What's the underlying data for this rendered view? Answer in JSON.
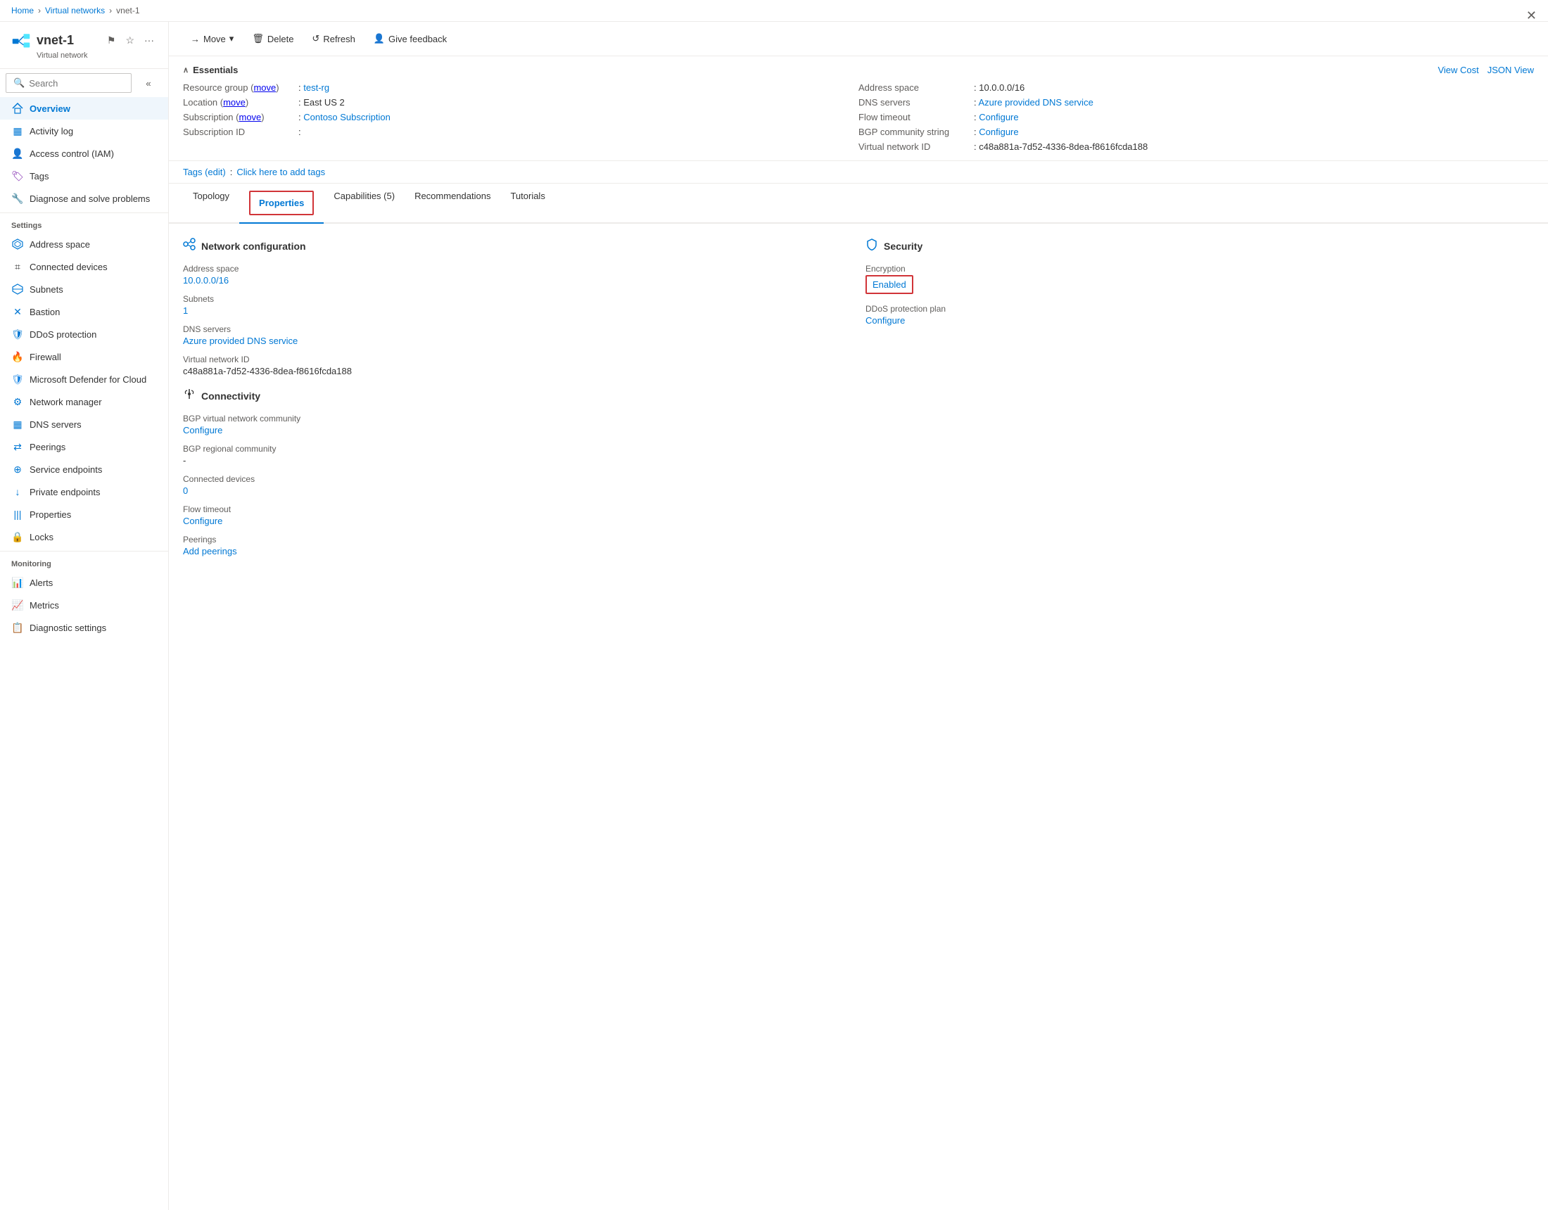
{
  "breadcrumb": {
    "home": "Home",
    "section": "Virtual networks",
    "current": "vnet-1"
  },
  "sidebar": {
    "title": "vnet-1",
    "subtitle": "Virtual network",
    "search_placeholder": "Search",
    "collapse_label": "Collapse",
    "nav_items": [
      {
        "id": "overview",
        "label": "Overview",
        "icon": "◈",
        "active": true,
        "color": "nav-color-overview"
      },
      {
        "id": "activity-log",
        "label": "Activity log",
        "icon": "▦",
        "active": false,
        "color": "nav-color-activity"
      },
      {
        "id": "iam",
        "label": "Access control (IAM)",
        "icon": "👤",
        "active": false,
        "color": "nav-color-iam"
      },
      {
        "id": "tags",
        "label": "Tags",
        "icon": "🏷",
        "active": false,
        "color": "nav-color-tags"
      },
      {
        "id": "diagnose",
        "label": "Diagnose and solve problems",
        "icon": "🔧",
        "active": false,
        "color": "nav-color-diag"
      }
    ],
    "settings_label": "Settings",
    "settings_items": [
      {
        "id": "address-space",
        "label": "Address space",
        "icon": "◈",
        "active": false,
        "color": "nav-color-address"
      },
      {
        "id": "connected-devices",
        "label": "Connected devices",
        "icon": "⌗",
        "active": false,
        "color": "nav-color-devices"
      },
      {
        "id": "subnets",
        "label": "Subnets",
        "icon": "◈",
        "active": false,
        "color": "nav-color-subnets"
      },
      {
        "id": "bastion",
        "label": "Bastion",
        "icon": "✕",
        "active": false,
        "color": "nav-color-bastion"
      },
      {
        "id": "ddos",
        "label": "DDoS protection",
        "icon": "🛡",
        "active": false,
        "color": "nav-color-ddos"
      },
      {
        "id": "firewall",
        "label": "Firewall",
        "icon": "🔥",
        "active": false,
        "color": "nav-color-firewall"
      },
      {
        "id": "defender",
        "label": "Microsoft Defender for Cloud",
        "icon": "🛡",
        "active": false,
        "color": "nav-color-defender"
      },
      {
        "id": "netmgr",
        "label": "Network manager",
        "icon": "⚙",
        "active": false,
        "color": "nav-color-netmgr"
      },
      {
        "id": "dns",
        "label": "DNS servers",
        "icon": "▦",
        "active": false,
        "color": "nav-color-dns"
      },
      {
        "id": "peerings",
        "label": "Peerings",
        "icon": "⇄",
        "active": false,
        "color": "nav-color-peerings"
      },
      {
        "id": "svcend",
        "label": "Service endpoints",
        "icon": "⊕",
        "active": false,
        "color": "nav-color-svcend"
      },
      {
        "id": "priv",
        "label": "Private endpoints",
        "icon": "↓",
        "active": false,
        "color": "nav-color-priv"
      },
      {
        "id": "props",
        "label": "Properties",
        "icon": "|||",
        "active": false,
        "color": "nav-color-props"
      },
      {
        "id": "locks",
        "label": "Locks",
        "icon": "🔒",
        "active": false,
        "color": "nav-color-locks"
      }
    ],
    "monitoring_label": "Monitoring",
    "monitoring_items": [
      {
        "id": "alerts",
        "label": "Alerts",
        "icon": "📊",
        "active": false,
        "color": "nav-color-alerts"
      },
      {
        "id": "metrics",
        "label": "Metrics",
        "icon": "📈",
        "active": false,
        "color": "nav-color-metrics"
      },
      {
        "id": "diagset",
        "label": "Diagnostic settings",
        "icon": "📋",
        "active": false,
        "color": "nav-color-diagset"
      }
    ]
  },
  "toolbar": {
    "move_label": "Move",
    "delete_label": "Delete",
    "refresh_label": "Refresh",
    "feedback_label": "Give feedback"
  },
  "essentials": {
    "header": "Essentials",
    "view_cost": "View Cost",
    "json_view": "JSON View",
    "fields": {
      "resource_group_label": "Resource group (move)",
      "resource_group_value": "test-rg",
      "location_label": "Location (move)",
      "location_value": "East US 2",
      "subscription_label": "Subscription (move)",
      "subscription_value": "Contoso Subscription",
      "subscription_id_label": "Subscription ID",
      "subscription_id_value": "",
      "address_space_label": "Address space",
      "address_space_value": "10.0.0.0/16",
      "dns_servers_label": "DNS servers",
      "dns_servers_value": "Azure provided DNS service",
      "flow_timeout_label": "Flow timeout",
      "flow_timeout_value": "Configure",
      "bgp_label": "BGP community string",
      "bgp_value": "Configure",
      "vnet_id_label": "Virtual network ID",
      "vnet_id_value": "c48a881a-7d52-4336-8dea-f8616fcda188"
    }
  },
  "tags": {
    "label": "Tags (edit)",
    "link_label": "Click here to add tags"
  },
  "tabs": {
    "items": [
      {
        "id": "topology",
        "label": "Topology"
      },
      {
        "id": "properties",
        "label": "Properties",
        "active": true
      },
      {
        "id": "capabilities",
        "label": "Capabilities (5)"
      },
      {
        "id": "recommendations",
        "label": "Recommendations"
      },
      {
        "id": "tutorials",
        "label": "Tutorials"
      }
    ]
  },
  "properties": {
    "network_config": {
      "section_title": "Network configuration",
      "address_space_label": "Address space",
      "address_space_value": "10.0.0.0/16",
      "subnets_label": "Subnets",
      "subnets_value": "1",
      "dns_label": "DNS servers",
      "dns_value": "Azure provided DNS service",
      "vnet_id_label": "Virtual network ID",
      "vnet_id_value": "c48a881a-7d52-4336-8dea-f8616fcda188"
    },
    "security": {
      "section_title": "Security",
      "encryption_label": "Encryption",
      "encryption_value": "Enabled",
      "ddos_label": "DDoS protection plan",
      "ddos_value": "Configure"
    },
    "connectivity": {
      "section_title": "Connectivity",
      "bgp_community_label": "BGP virtual network community",
      "bgp_community_value": "Configure",
      "bgp_regional_label": "BGP regional community",
      "bgp_regional_value": "-",
      "connected_devices_label": "Connected devices",
      "connected_devices_value": "0",
      "flow_timeout_label": "Flow timeout",
      "flow_timeout_value": "Configure",
      "peerings_label": "Peerings",
      "peerings_value": "Add peerings"
    }
  },
  "close_button_label": "✕"
}
